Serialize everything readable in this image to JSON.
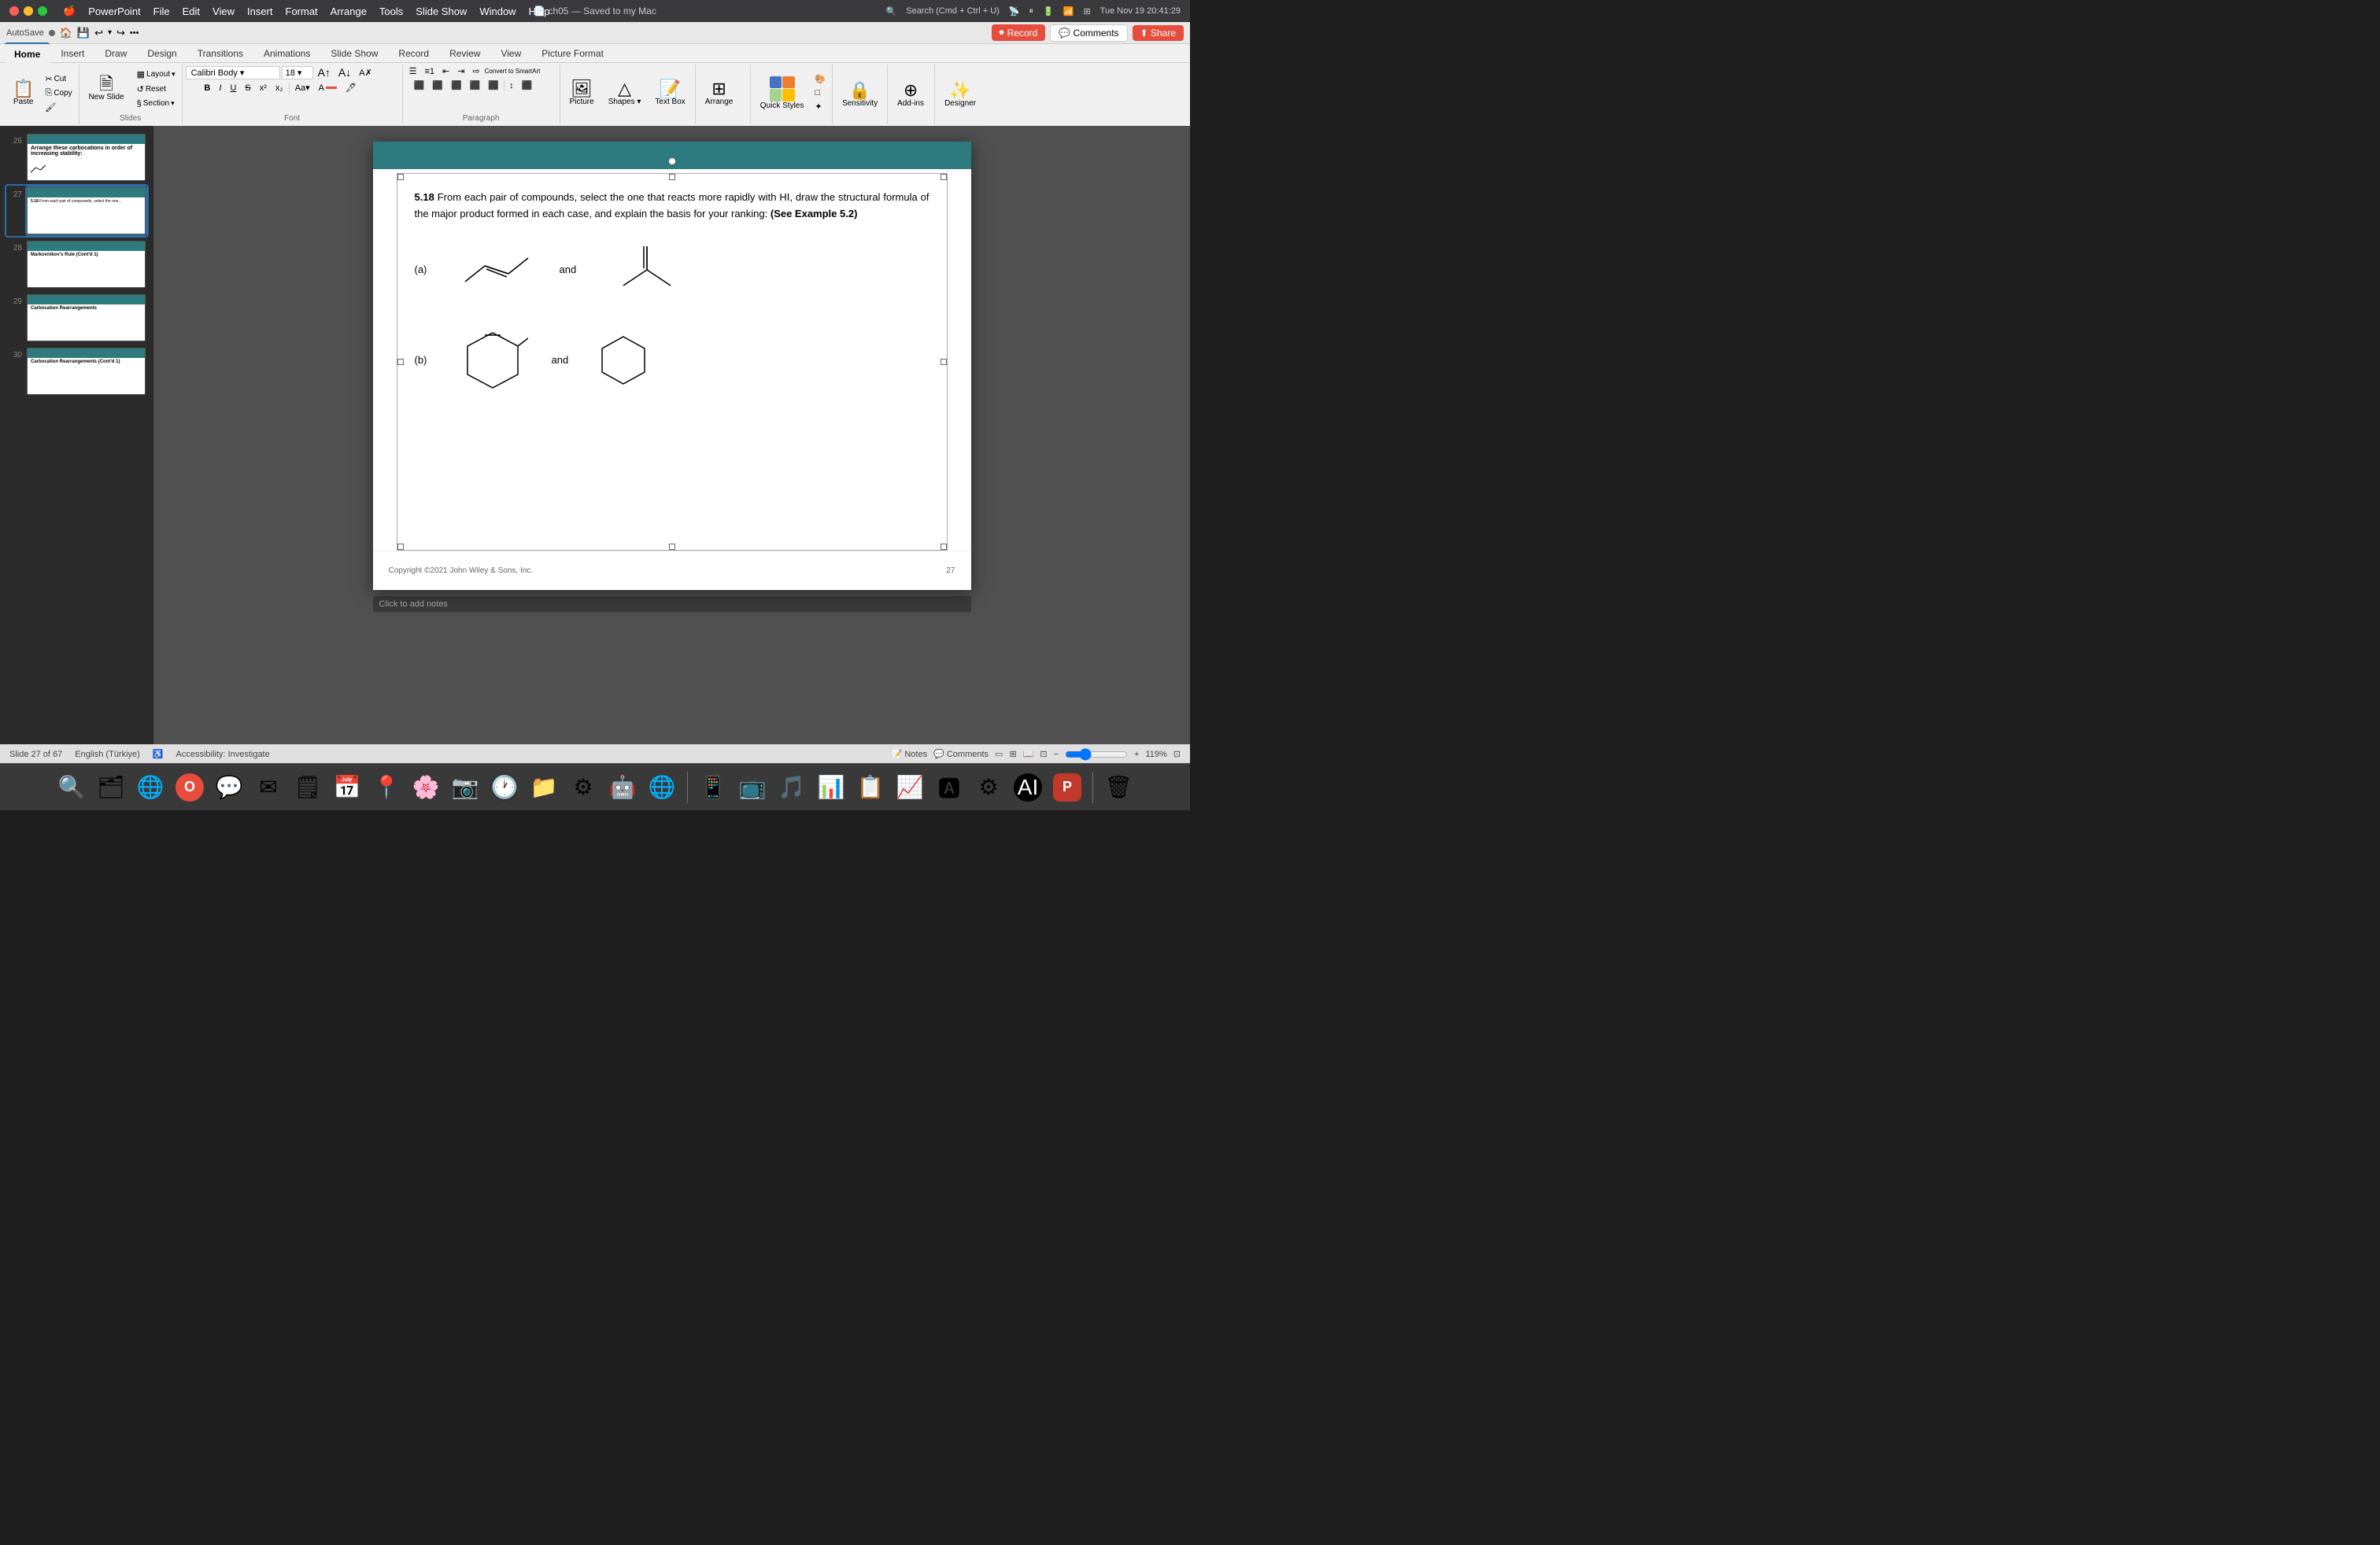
{
  "titlebar": {
    "app": "PowerPoint",
    "menus": [
      "Apple",
      "PowerPoint",
      "File",
      "Edit",
      "View",
      "Insert",
      "Format",
      "Arrange",
      "Tools",
      "Slide Show",
      "Window",
      "Help"
    ],
    "filename": "ch05 — Saved to my Mac",
    "autosave": "AutoSave",
    "time": "Tue Nov 19  20:41:29",
    "search_placeholder": "Search (Cmd + Ctrl + U)"
  },
  "ribbon": {
    "tabs": [
      "Home",
      "Insert",
      "Draw",
      "Design",
      "Transitions",
      "Animations",
      "Slide Show",
      "Record",
      "Review",
      "View",
      "Picture Format"
    ],
    "active_tab": "Home",
    "groups": {
      "clipboard": {
        "label": "",
        "paste": "Paste",
        "cut_icon": "✂",
        "copy_icon": "⎘",
        "format_icon": "🖌"
      },
      "slides": {
        "new_slide": "New Slide",
        "layout": "Layout",
        "reset": "Reset",
        "section": "Section"
      },
      "font": {
        "bold": "B",
        "italic": "I",
        "underline": "U"
      },
      "picture": {
        "label": "Picture"
      },
      "textbox": {
        "label": "Text Box"
      },
      "arrange": {
        "label": "Arrange"
      },
      "quickstyles": {
        "label": "Quick Styles"
      },
      "sensitivity": {
        "label": "Sensitivity"
      },
      "addins": {
        "label": "Add-ins"
      },
      "designer": {
        "label": "Designer"
      }
    }
  },
  "action_buttons": {
    "record": "Record",
    "comments": "Comments",
    "share": "Share"
  },
  "slides": {
    "current": 27,
    "total": 67,
    "items": [
      {
        "num": 26,
        "active": false
      },
      {
        "num": 27,
        "active": true
      },
      {
        "num": 28,
        "active": false
      },
      {
        "num": 29,
        "active": false
      },
      {
        "num": 30,
        "active": false
      }
    ]
  },
  "slide27": {
    "header_color": "#2d7b7e",
    "question_number": "5.18",
    "question_text": "From each pair of compounds, select the one that reacts more rapidly with HI, draw the structural formula of the major product formed in each case, and explain the basis for your ranking:",
    "see_example": "(See Example 5.2)",
    "part_a_label": "(a)",
    "part_b_label": "(b)",
    "and_text": "and",
    "footer_copyright": "Copyright ©2021 John Wiley & Sons, Inc.",
    "slide_number": "27"
  },
  "statusbar": {
    "slide_info": "Slide 27 of 67",
    "language": "English (Türkiye)",
    "accessibility": "Accessibility: Investigate",
    "notes": "Notes",
    "comments": "Comments",
    "zoom": "119%"
  },
  "dock": {
    "items": [
      "🔍",
      "🗂",
      "🌐",
      "🔴",
      "📱",
      "📷",
      "📞",
      "✉",
      "🗒",
      "📅",
      "📍",
      "🌸",
      "📁",
      "⚙",
      "🤖",
      "🌍",
      "🟢",
      "📊",
      "📋",
      "📈",
      "🎵",
      "📺",
      "💻",
      "🧩",
      "🔄",
      "🗑"
    ]
  }
}
